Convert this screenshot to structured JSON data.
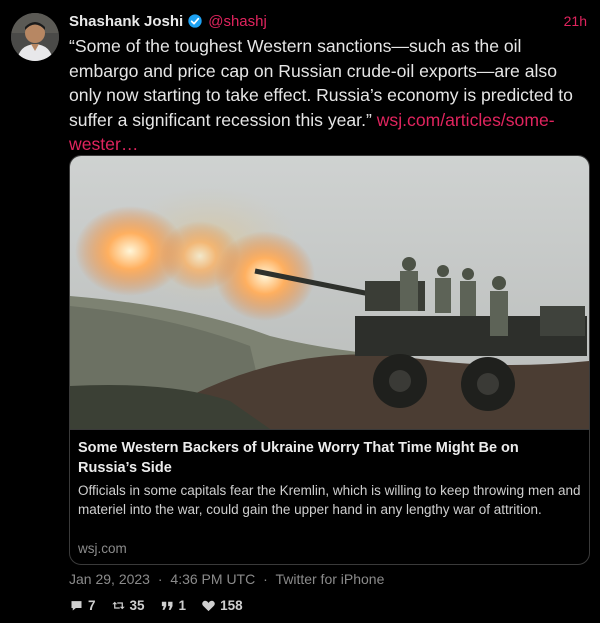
{
  "tweet": {
    "author_name": "Shashank Joshi",
    "handle": "@shashj",
    "relative_time": "21h",
    "text": "“Some of the toughest Western sanctions—such as the oil embargo and price cap on Russian crude-oil exports—are also only now starting to take effect. Russia’s economy is predicted to suffer a significant recession this year.”",
    "link_text": "wsj.com/articles/some-wester…",
    "timestamp": "Jan 29, 2023 · 4:36 PM UTC · Twitter for iPhone",
    "date": "Jan 29, 2023",
    "time": "4:36 PM UTC",
    "source": "Twitter for iPhone",
    "separator": "·"
  },
  "card": {
    "title": "Some Western Backers of Ukraine Worry That Time Might Be on Russia’s Side",
    "description": "Officials in some capitals fear the Kremlin, which is willing to keep throwing men and materiel into the war, could gain the upper hand in any lengthy war of attrition.",
    "domain": "wsj.com"
  },
  "stats": {
    "replies": "7",
    "retweets": "35",
    "quotes": "1",
    "likes": "158"
  },
  "colors": {
    "background": "#000000",
    "accent": "#e0245e",
    "verified": "#1da1f2",
    "muted": "#8b8b8b"
  },
  "icons": [
    "verified-badge-icon",
    "reply-icon",
    "retweet-icon",
    "quote-icon",
    "like-icon"
  ]
}
